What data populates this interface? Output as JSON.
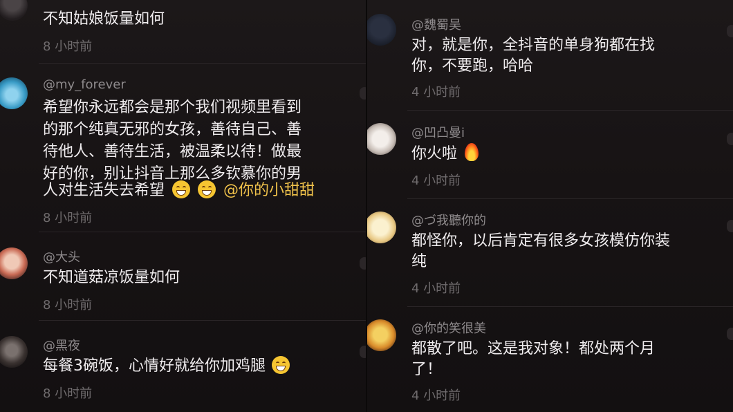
{
  "left_panel": {
    "comments": [
      {
        "username": "",
        "lines": [
          "不知姑娘饭量如何"
        ],
        "time": "8 小时前"
      },
      {
        "username": "@my_forever",
        "lines": [
          "希望你永远都会是那个我们视频里看到",
          "的那个纯真无邪的女孩，善待自己、善",
          "待他人、善待生活，被温柔以待！做最",
          "好的你，别让抖音上那么多钦慕你的男",
          "人对生活失去希望"
        ],
        "mention": "@你的小甜甜",
        "time": "8 小时前"
      },
      {
        "username": "@大头",
        "lines": [
          "不知道菇凉饭量如何"
        ],
        "time": "8 小时前"
      },
      {
        "username": "@黑夜",
        "lines": [
          "每餐3碗饭，心情好就给你加鸡腿"
        ],
        "time": "8 小时前"
      }
    ]
  },
  "right_panel": {
    "comments": [
      {
        "username": "@魏蜀吴",
        "lines": [
          "对，就是你，全抖音的单身狗都在找",
          "你，不要跑，哈哈"
        ],
        "time": "4 小时前"
      },
      {
        "username": "@凹凸曼i",
        "lines": [
          "你火啦"
        ],
        "time": "4 小时前"
      },
      {
        "username": "@づ我聽你的",
        "lines": [
          "都怪你，以后肯定有很多女孩模仿你装",
          "纯"
        ],
        "time": "4 小时前"
      },
      {
        "username": "@你的笑很美",
        "lines": [
          "都散了吧。这是我对象！都处两个月",
          "了！"
        ],
        "time": "4 小时前"
      }
    ]
  },
  "icons": [
    "laughing-emoji-icon",
    "tears-of-joy-emoji-icon",
    "grinning-emoji-icon",
    "fire-emoji-icon"
  ]
}
